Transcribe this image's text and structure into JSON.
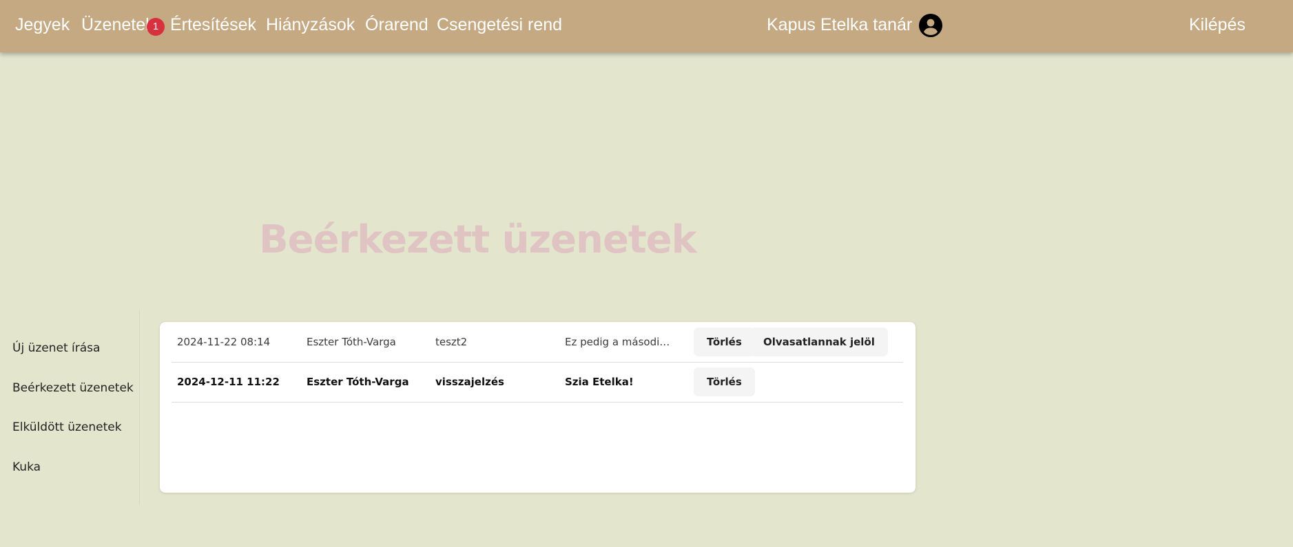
{
  "nav": {
    "items": [
      "Jegyek",
      "Üzenetek",
      "Értesítések",
      "Hiányzások",
      "Órarend",
      "Csengetési rend"
    ],
    "unread_badge": "1",
    "user": "Kapus Etelka tanár",
    "user_icon": "account-circle-icon",
    "logout": "Kilépés"
  },
  "title": "Beérkezett üzenetek",
  "sidebar": {
    "items": [
      "Új üzenet írása",
      "Beérkezett üzenetek",
      "Elküldött üzenetek",
      "Kuka"
    ]
  },
  "messages": [
    {
      "date": "2024-11-22 08:14",
      "from": "Eszter Tóth-Varga",
      "subject": "teszt2",
      "preview": "Ez pedig a második t...",
      "read": true,
      "delete_label": "Törlés",
      "mark_unread_label": "Olvasatlannak jelöl"
    },
    {
      "date": "2024-12-11 11:22",
      "from": "Eszter Tóth-Varga",
      "subject": "visszajelzés",
      "preview": "Szia Etelka!",
      "read": false,
      "delete_label": "Törlés"
    }
  ],
  "colors": {
    "topbar": "#c4a983",
    "background": "#e3e5cd",
    "title": "#dfc4c3",
    "badge": "#d9303f"
  }
}
